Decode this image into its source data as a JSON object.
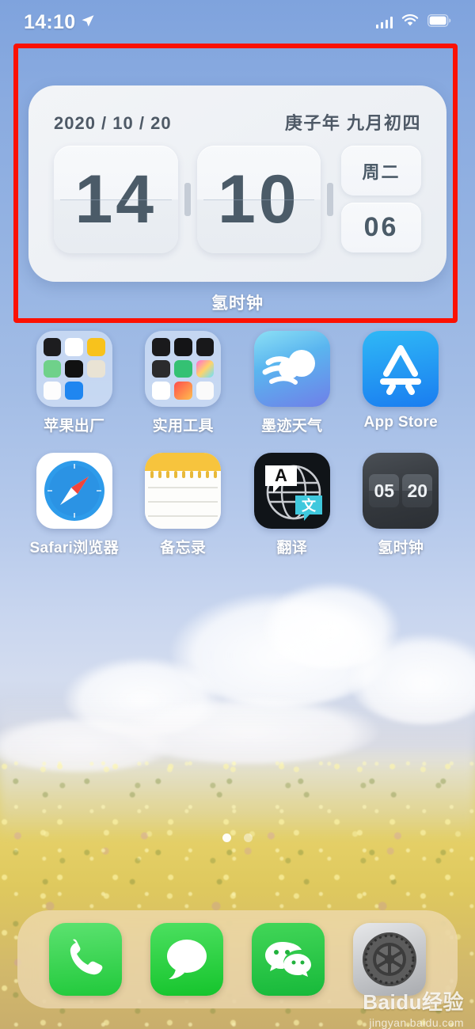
{
  "status_bar": {
    "time": "14:10",
    "location_icon": "location-arrow-icon",
    "signal_icon": "cellular-signal-icon",
    "wifi_icon": "wifi-icon",
    "battery_icon": "battery-icon"
  },
  "annotation": {
    "color": "#fb1103",
    "target": "clock-widget"
  },
  "widget": {
    "date": "2020 / 10 / 20",
    "lunar": "庚子年  九月初四",
    "hours": "14",
    "minutes": "10",
    "weekday": "周二",
    "seconds": "06",
    "label": "氢时钟"
  },
  "apps": {
    "row1": [
      {
        "name": "苹果出厂",
        "type": "folder"
      },
      {
        "name": "实用工具",
        "type": "folder"
      },
      {
        "name": "墨迹天气",
        "type": "app"
      },
      {
        "name": "App Store",
        "type": "app"
      }
    ],
    "row2": [
      {
        "name": "Safari浏览器",
        "type": "app"
      },
      {
        "name": "备忘录",
        "type": "app"
      },
      {
        "name": "翻译",
        "type": "app"
      },
      {
        "name": "氢时钟",
        "type": "app",
        "badge_left": "05",
        "badge_right": "20"
      }
    ]
  },
  "page_dots": {
    "count": 2,
    "active_index": 0
  },
  "dock": [
    {
      "name": "电话",
      "icon": "phone-icon"
    },
    {
      "name": "信息",
      "icon": "messages-icon"
    },
    {
      "name": "微信",
      "icon": "wechat-icon"
    },
    {
      "name": "设置",
      "icon": "settings-gear-icon"
    }
  ],
  "watermark": {
    "main": "Baidu经验",
    "sub": "jingyan.baidu.com"
  }
}
